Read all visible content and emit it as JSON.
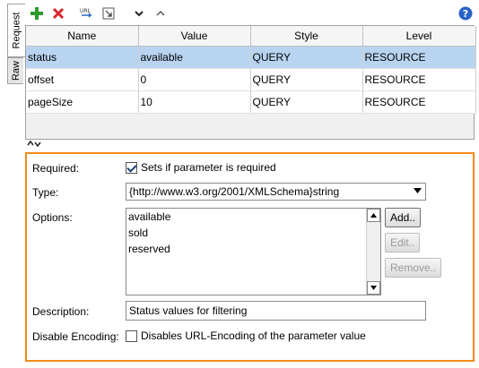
{
  "tabs": [
    {
      "label": "Request"
    },
    {
      "label": "Raw"
    }
  ],
  "toolbar": {
    "add_icon": "plus-icon",
    "delete_icon": "x-icon",
    "url_icon": "url-icon",
    "extract_icon": "extract-icon",
    "down_icon": "chevron-down-icon",
    "up_icon": "chevron-up-icon",
    "help_icon": "help-icon"
  },
  "table": {
    "columns": [
      "Name",
      "Value",
      "Style",
      "Level"
    ],
    "rows": [
      {
        "name": "status",
        "value": "available",
        "style": "QUERY",
        "level": "RESOURCE"
      },
      {
        "name": "offset",
        "value": "0",
        "style": "QUERY",
        "level": "RESOURCE"
      },
      {
        "name": "pageSize",
        "value": "10",
        "style": "QUERY",
        "level": "RESOURCE"
      }
    ]
  },
  "details": {
    "required_label": "Required:",
    "required_text": "Sets if parameter is required",
    "type_label": "Type:",
    "type_value": "{http://www.w3.org/2001/XMLSchema}string",
    "options_label": "Options:",
    "options": [
      "available",
      "sold",
      "reserved"
    ],
    "add_button": "Add..",
    "edit_button": "Edit..",
    "remove_button": "Remove..",
    "description_label": "Description:",
    "description_value": "Status values for filtering",
    "disable_encoding_label": "Disable Encoding:",
    "disable_encoding_text": "Disables URL-Encoding of the parameter value"
  },
  "colors": {
    "accent_border": "#f28a1a",
    "selected_row": "#b9d4f1"
  }
}
